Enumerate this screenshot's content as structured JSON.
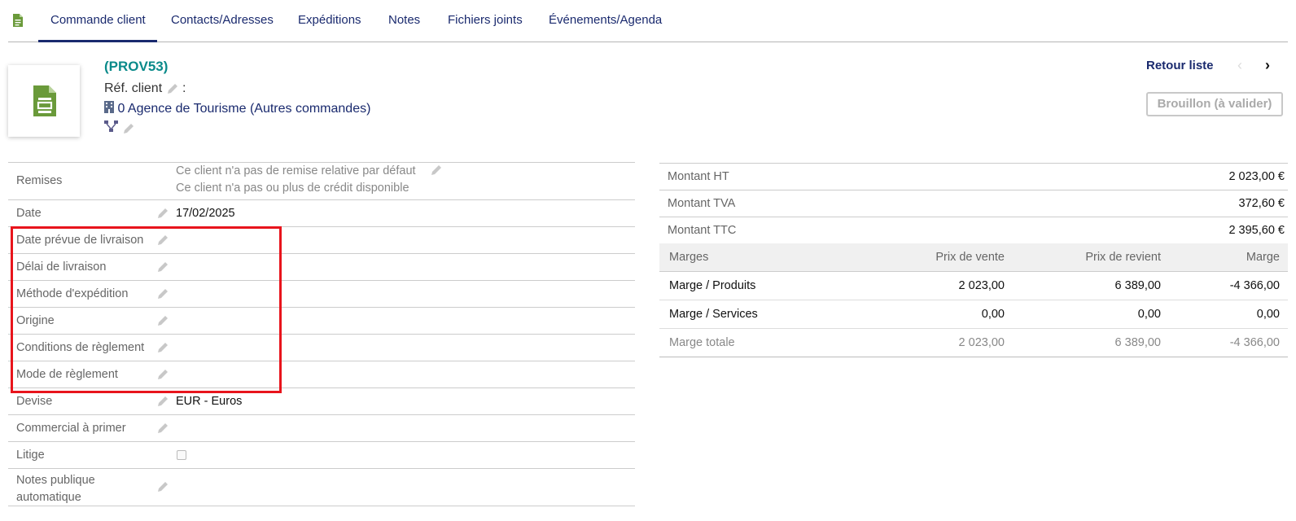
{
  "tabs": [
    {
      "label": "Commande client",
      "active": true
    },
    {
      "label": "Contacts/Adresses"
    },
    {
      "label": "Expéditions"
    },
    {
      "label": "Notes"
    },
    {
      "label": "Fichiers joints"
    },
    {
      "label": "Événements/Agenda"
    }
  ],
  "header": {
    "ref": "(PROV53)",
    "ref_client_label": "Réf. client",
    "ref_client_sep": " :",
    "thirdparty_name": "0 Agence de Tourisme",
    "thirdparty_other": "(Autres commandes)",
    "retour_liste": "Retour liste",
    "status": "Brouillon (à valider)"
  },
  "fields": {
    "remises_label": "Remises",
    "remises_line1": "Ce client n'a pas de remise relative par défaut",
    "remises_line2": "Ce client n'a pas ou plus de crédit disponible",
    "date_label": "Date",
    "date_value": "17/02/2025",
    "date_livraison_label": "Date prévue de livraison",
    "delai_label": "Délai de livraison",
    "methode_label": "Méthode d'expédition",
    "origine_label": "Origine",
    "conditions_label": "Conditions de règlement",
    "mode_label": "Mode de règlement",
    "devise_label": "Devise",
    "devise_value": "EUR - Euros",
    "commercial_label": "Commercial à primer",
    "litige_label": "Litige",
    "notes_label_1": "Notes publique",
    "notes_label_2": "automatique"
  },
  "totals": {
    "ht_label": "Montant HT",
    "ht_value": "2 023,00 €",
    "tva_label": "Montant TVA",
    "tva_value": "372,60 €",
    "ttc_label": "Montant TTC",
    "ttc_value": "2 395,60 €"
  },
  "margins": {
    "headers": [
      "Marges",
      "Prix de vente",
      "Prix de revient",
      "Marge"
    ],
    "rows": [
      [
        "Marge / Produits",
        "2 023,00",
        "6 389,00",
        "-4 366,00"
      ],
      [
        "Marge / Services",
        "0,00",
        "0,00",
        "0,00"
      ],
      [
        "Marge totale",
        "2 023,00",
        "6 389,00",
        "-4 366,00"
      ]
    ]
  },
  "colors": {
    "accent": "#1a2a6e",
    "ref": "#0a8a8a",
    "highlight": "#e8141c",
    "doc_icon": "#6a9a3a"
  }
}
